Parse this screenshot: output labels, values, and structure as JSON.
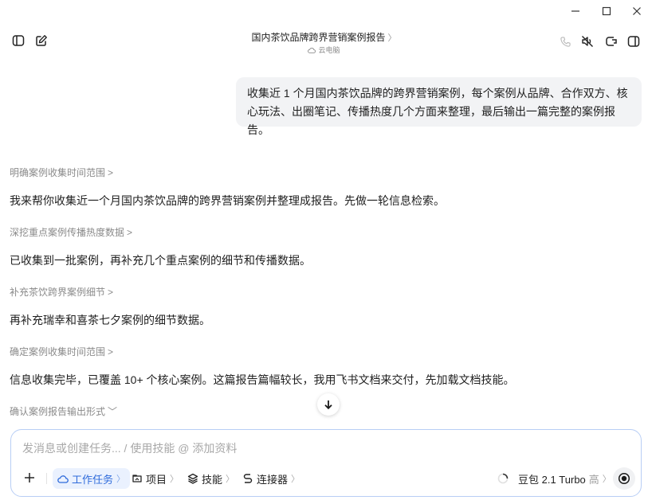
{
  "window": {
    "minimize_icon": "minimize-icon",
    "maximize_icon": "maximize-icon",
    "close_icon": "close-icon"
  },
  "header": {
    "title": "国内茶饮品牌跨界营销案例报告",
    "title_chevron": "〉",
    "subtitle": "云电脑",
    "left_icons": [
      "sidebar-toggle-icon",
      "new-chat-icon"
    ],
    "right_icons": [
      "phone-icon",
      "mute-icon",
      "cloud-pc-icon",
      "panel-icon"
    ]
  },
  "conversation": {
    "user_message": "收集近 1 个月国内茶饮品牌的跨界营销案例，每个案例从品牌、合作双方、核心玩法、出圈笔记、传播热度几个方面来整理，最后输出一篇完整的案例报告。",
    "steps": [
      {
        "label": "明确案例收集时间范围",
        "chevron": ">",
        "text": "我来帮你收集近一个月国内茶饮品牌的跨界营销案例并整理成报告。先做一轮信息检索。"
      },
      {
        "label": "深挖重点案例传播热度数据",
        "chevron": ">",
        "text": "已收集到一批案例，再补充几个重点案例的细节和传播数据。"
      },
      {
        "label": "补充茶饮跨界案例细节",
        "chevron": ">",
        "text": "再补充瑞幸和喜茶七夕案例的细节数据。"
      },
      {
        "label": "确定案例收集时间范围",
        "chevron": ">",
        "text": "信息收集完毕，已覆盖 10+ 个核心案例。这篇报告篇幅较长，我用飞书文档来交付，先加载文档技能。"
      },
      {
        "label": "确认案例报告输出形式",
        "chevron": "﹀",
        "text": ""
      }
    ]
  },
  "composer": {
    "placeholder": "发消息或创建任务... / 使用技能 @ 添加资料",
    "value": "",
    "chips": [
      {
        "label": "工作任务",
        "chevron": "〉",
        "icon": "cloud-icon",
        "active": true
      },
      {
        "label": "项目",
        "chevron": "〉",
        "icon": "project-icon",
        "active": false
      },
      {
        "label": "技能",
        "chevron": "〉",
        "icon": "skill-icon",
        "active": false
      },
      {
        "label": "连接器",
        "chevron": "〉",
        "icon": "connector-icon",
        "active": false
      }
    ],
    "model": {
      "name": "豆包 2.1 Turbo",
      "level": "高",
      "chevron": "〉"
    }
  },
  "colors": {
    "accent": "#2f6bdb",
    "bubble": "#f2f3f5",
    "composer_border": "#b8cef5"
  }
}
